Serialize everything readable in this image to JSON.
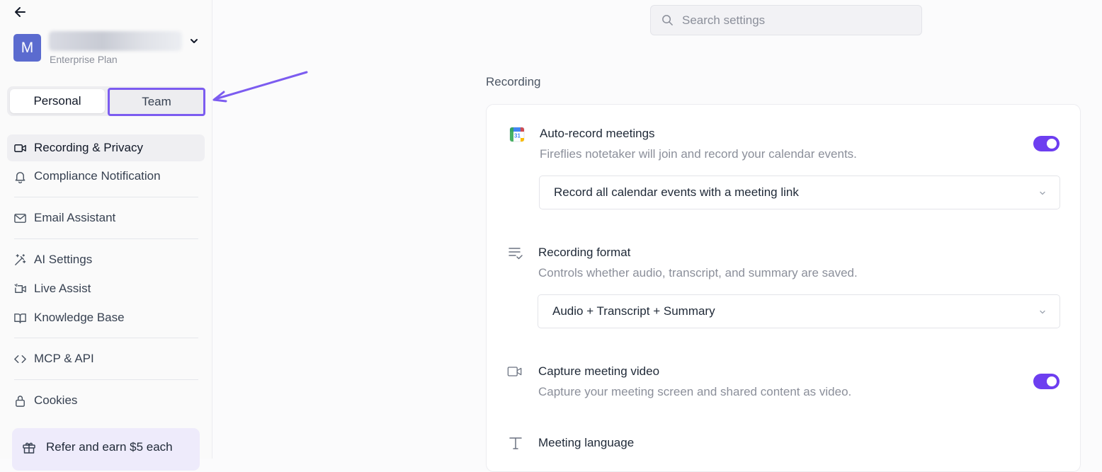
{
  "sidebar": {
    "workspace": {
      "avatar_letter": "M",
      "plan": "Enterprise Plan"
    },
    "tabs": {
      "personal": "Personal",
      "team": "Team"
    },
    "items": [
      {
        "label": "Recording & Privacy",
        "icon": "video-icon",
        "active": true
      },
      {
        "label": "Compliance Notification",
        "icon": "bell-icon"
      },
      {
        "label": "Email Assistant",
        "icon": "mail-icon"
      },
      {
        "label": "AI Settings",
        "icon": "magic-wand-icon"
      },
      {
        "label": "Live Assist",
        "icon": "live-video-icon"
      },
      {
        "label": "Knowledge Base",
        "icon": "book-icon"
      },
      {
        "label": "MCP & API",
        "icon": "code-icon"
      },
      {
        "label": "Cookies",
        "icon": "lock-icon"
      }
    ],
    "refer": {
      "label": "Refer and earn $5 each",
      "icon": "gift-icon"
    }
  },
  "search": {
    "placeholder": "Search settings"
  },
  "main": {
    "section_title": "Recording",
    "settings": [
      {
        "title": "Auto-record meetings",
        "desc": "Fireflies notetaker will join and record your calendar events.",
        "icon": "calendar-icon",
        "toggle": true,
        "select": "Record all calendar events with a meeting link"
      },
      {
        "title": "Recording format",
        "desc": "Controls whether audio, transcript, and summary are saved.",
        "icon": "list-check-icon",
        "select": "Audio + Transcript + Summary"
      },
      {
        "title": "Capture meeting video",
        "desc": "Capture your meeting screen and shared content as video.",
        "icon": "video-icon",
        "toggle": true
      },
      {
        "title": "Meeting language",
        "icon": "text-icon"
      }
    ]
  },
  "colors": {
    "accent": "#6d3ef0",
    "highlight": "#7c5cf0",
    "avatar": "#5b6bcf"
  }
}
